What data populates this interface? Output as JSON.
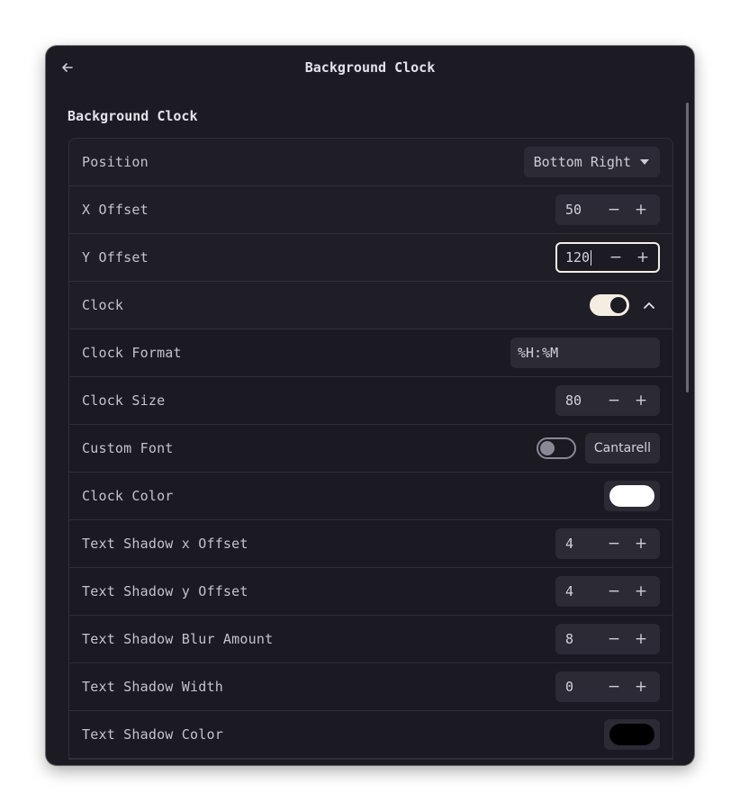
{
  "window": {
    "title": "Background Clock"
  },
  "section": {
    "title": "Background Clock"
  },
  "colors": {
    "clock_color": "#ffffff",
    "shadow_color": "#000000"
  },
  "rows": {
    "position": {
      "label": "Position",
      "value": "Bottom Right"
    },
    "x_offset": {
      "label": "X Offset",
      "value": "50"
    },
    "y_offset": {
      "label": "Y Offset",
      "value": "120"
    },
    "clock": {
      "label": "Clock",
      "enabled": true
    },
    "clock_format": {
      "label": "Clock Format",
      "value": "%H:%M"
    },
    "clock_size": {
      "label": "Clock Size",
      "value": "80"
    },
    "custom_font": {
      "label": "Custom Font",
      "enabled": false,
      "font": "Cantarell"
    },
    "clock_color": {
      "label": "Clock Color"
    },
    "shadow_x": {
      "label": "Text Shadow x Offset",
      "value": "4"
    },
    "shadow_y": {
      "label": "Text Shadow y Offset",
      "value": "4"
    },
    "shadow_blur": {
      "label": "Text Shadow Blur Amount",
      "value": "8"
    },
    "shadow_width": {
      "label": "Text Shadow Width",
      "value": "0"
    },
    "shadow_color": {
      "label": "Text Shadow Color"
    }
  },
  "spin": {
    "minus": "−",
    "plus": "+"
  }
}
